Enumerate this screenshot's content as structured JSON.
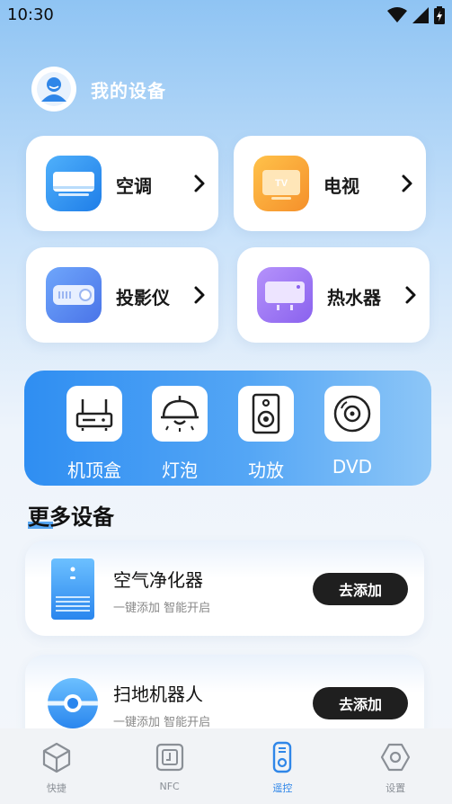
{
  "status": {
    "time": "10:30"
  },
  "profile": {
    "title": "我的设备"
  },
  "devices": [
    {
      "label": "空调"
    },
    {
      "label": "电视"
    },
    {
      "label": "投影仪"
    },
    {
      "label": "热水器"
    }
  ],
  "quick": [
    {
      "label": "机顶盒"
    },
    {
      "label": "灯泡"
    },
    {
      "label": "功放"
    },
    {
      "label": "DVD"
    }
  ],
  "tv_badge": "TV",
  "more": {
    "title": "更多设备",
    "items": [
      {
        "title": "空气净化器",
        "subtitle": "一键添加  智能开启",
        "button": "去添加"
      },
      {
        "title": "扫地机器人",
        "subtitle": "一键添加  智能开启",
        "button": "去添加"
      }
    ]
  },
  "tabs": [
    {
      "label": "快捷",
      "icon": "cube-icon"
    },
    {
      "label": "NFC",
      "icon": "nfc-icon"
    },
    {
      "label": "遥控",
      "icon": "remote-icon",
      "active": true
    },
    {
      "label": "设置",
      "icon": "hexagon-icon"
    }
  ],
  "colors": {
    "accent": "#2f86e8",
    "button": "#1f1f1f"
  }
}
